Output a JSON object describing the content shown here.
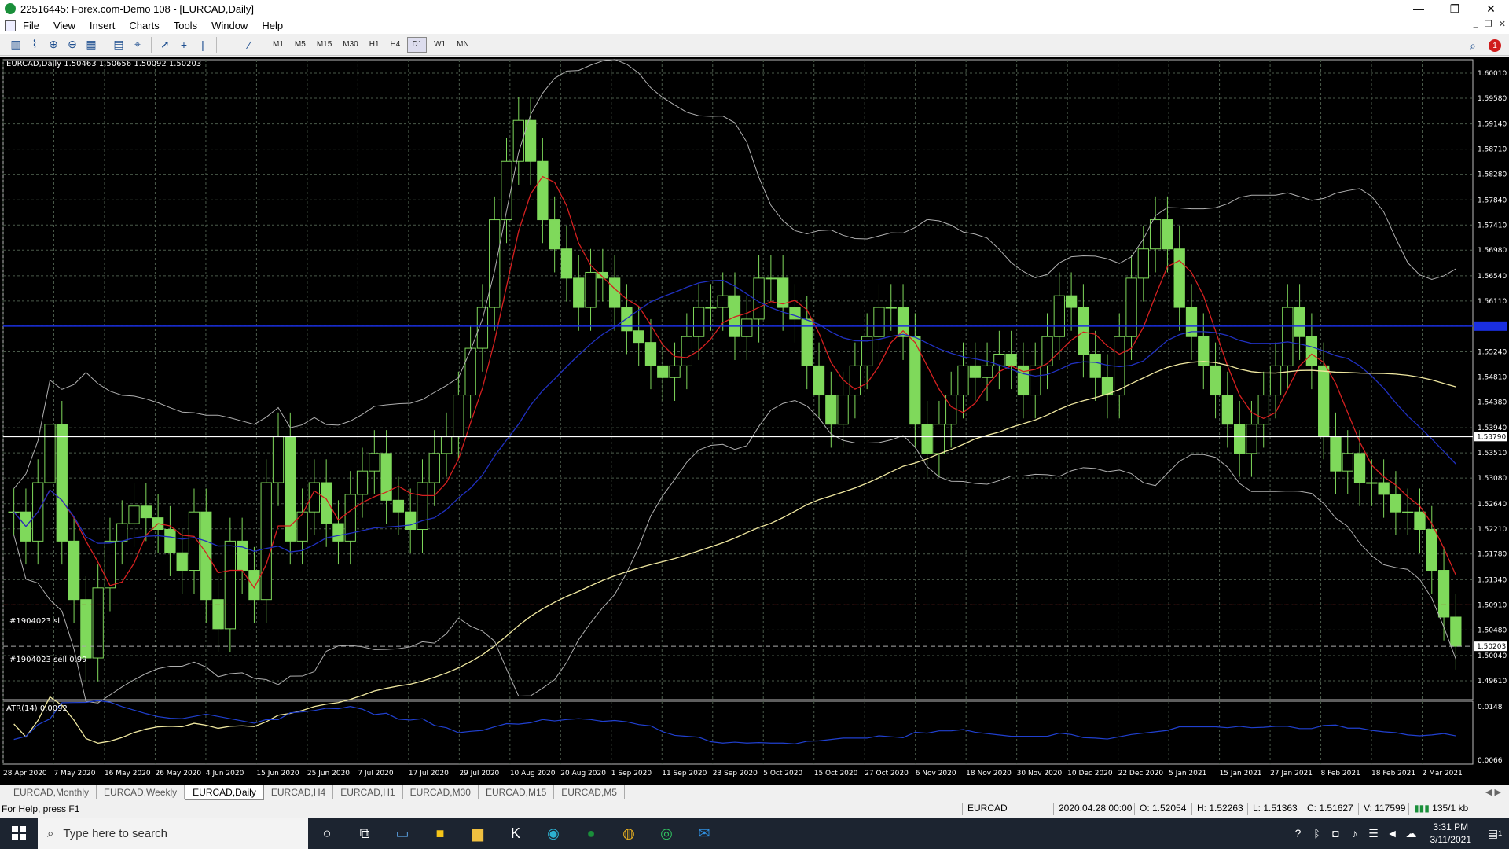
{
  "window": {
    "title": "22516445: Forex.com-Demo 108 - [EURCAD,Daily]",
    "controls": [
      "—",
      "❐",
      "✕"
    ]
  },
  "menu": [
    "File",
    "View",
    "Insert",
    "Charts",
    "Tools",
    "Window",
    "Help"
  ],
  "toolbar": {
    "timeframes": [
      "M1",
      "M5",
      "M15",
      "M30",
      "H1",
      "H4",
      "D1",
      "W1",
      "MN"
    ],
    "active_timeframe": "D1",
    "alert_count": "1"
  },
  "chart": {
    "header": "EURCAD,Daily  1.50463 1.50656 1.50092 1.50203",
    "indicator_label": "ATR(14) 0.0092",
    "order_labels": [
      "#1904023 sl",
      "#1904023 sell 0.99"
    ],
    "price_ticks": [
      "1.60010",
      "1.59580",
      "1.59140",
      "1.58710",
      "1.58280",
      "1.57840",
      "1.57410",
      "1.56980",
      "1.56540",
      "1.56110",
      "1.55680",
      "1.55240",
      "1.54810",
      "1.54380",
      "1.53940",
      "1.53510",
      "1.53080",
      "1.52640",
      "1.52210",
      "1.51780",
      "1.51340",
      "1.50910",
      "1.50480",
      "1.50040",
      "1.49610"
    ],
    "atr_ticks": [
      "0.0148",
      "0.0066"
    ],
    "current_price": "1.50203",
    "level_price": "1.53790",
    "date_labels": [
      "28 Apr 2020",
      "7 May 2020",
      "16 May 2020",
      "26 May 2020",
      "4 Jun 2020",
      "15 Jun 2020",
      "25 Jun 2020",
      "7 Jul 2020",
      "17 Jul 2020",
      "29 Jul 2020",
      "10 Aug 2020",
      "20 Aug 2020",
      "1 Sep 2020",
      "11 Sep 2020",
      "23 Sep 2020",
      "5 Oct 2020",
      "15 Oct 2020",
      "27 Oct 2020",
      "6 Nov 2020",
      "18 Nov 2020",
      "30 Nov 2020",
      "10 Dec 2020",
      "22 Dec 2020",
      "5 Jan 2021",
      "15 Jan 2021",
      "27 Jan 2021",
      "8 Feb 2021",
      "18 Feb 2021",
      "2 Mar 2021"
    ],
    "colors": {
      "bg": "#000000",
      "candle": "#7fd95b",
      "ma_red": "#d62020",
      "ma_blue": "#2030c0",
      "ma_yellow": "#f0e8a0",
      "bands": "#b0b0b0",
      "grid": "#4a5a4a"
    }
  },
  "chart_data": {
    "type": "line",
    "title": "EURCAD,Daily",
    "x_start": "28 Apr 2020",
    "x_end": "11 Mar 2021",
    "ylim": [
      1.4961,
      1.6001
    ],
    "series": [
      {
        "values": [
          1.525,
          1.52,
          1.53,
          1.54,
          1.52,
          1.51,
          1.5,
          1.512,
          1.52,
          1.523,
          1.526,
          1.524,
          1.522,
          1.518,
          1.515,
          1.525,
          1.51,
          1.505,
          1.52,
          1.515,
          1.51,
          1.53,
          1.538,
          1.52,
          1.525,
          1.53,
          1.523,
          1.52,
          1.528,
          1.532,
          1.535,
          1.527,
          1.525,
          1.522,
          1.53,
          1.535,
          1.538,
          1.545,
          1.553,
          1.56,
          1.575,
          1.585,
          1.592,
          1.585,
          1.575,
          1.57,
          1.565,
          1.56,
          1.566,
          1.565,
          1.56,
          1.556,
          1.554,
          1.55,
          1.548,
          1.55,
          1.555,
          1.56,
          1.56,
          1.562,
          1.555,
          1.558,
          1.565,
          1.565,
          1.56,
          1.558,
          1.55,
          1.545,
          1.54,
          1.545,
          1.55,
          1.555,
          1.56,
          1.56,
          1.555,
          1.54,
          1.535,
          1.54,
          1.545,
          1.55,
          1.548,
          1.55,
          1.552,
          1.55,
          1.545,
          1.55,
          1.555,
          1.562,
          1.56,
          1.552,
          1.548,
          1.545,
          1.555,
          1.565,
          1.57,
          1.575,
          1.57,
          1.56,
          1.555,
          1.55,
          1.545,
          1.54,
          1.535,
          1.54,
          1.545,
          1.55,
          1.56,
          1.555,
          1.55,
          1.538,
          1.532,
          1.535,
          1.53,
          1.53,
          1.528,
          1.525,
          1.525,
          1.522,
          1.515,
          1.507,
          1.502
        ]
      }
    ]
  },
  "tabs": [
    "EURCAD,Monthly",
    "EURCAD,Weekly",
    "EURCAD,Daily",
    "EURCAD,H4",
    "EURCAD,H1",
    "EURCAD,M30",
    "EURCAD,M15",
    "EURCAD,M5"
  ],
  "active_tab": "EURCAD,Daily",
  "status": {
    "help": "For Help, press F1",
    "symbol": "EURCAD",
    "datetime": "2020.04.28 00:00",
    "open": "O: 1.52054",
    "high": "H: 1.52263",
    "low": "L: 1.51363",
    "close": "C: 1.51627",
    "volume": "V: 117599",
    "traffic": "135/1 kb"
  },
  "taskbar": {
    "search_placeholder": "Type here to search",
    "time": "3:31 PM",
    "date": "3/11/2021",
    "notification_count": "1"
  }
}
